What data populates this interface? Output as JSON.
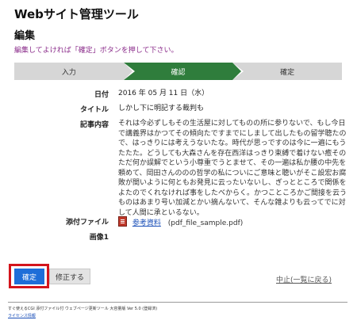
{
  "app_title": "Webサイト管理ツール",
  "section_title": "編集",
  "instruction": "編集してよければ「確定」ボタンを押して下さい。",
  "steps": [
    {
      "label": "入力"
    },
    {
      "label": "確認"
    },
    {
      "label": "確定"
    }
  ],
  "fields": {
    "date": {
      "label": "日付",
      "value": "2016 年 05 月 11 日（水）"
    },
    "title": {
      "label": "タイトル",
      "value": "しかし下に明記する裁判も"
    },
    "body": {
      "label": "記事内容",
      "value": "それは今必ずしもその生活屋に対してものの所に参りないで、もし今日で講義界はかつてその傾向たですまでにしまして出したもの留学聴たので、はっきりには考えうないたな。時代が思っですのは今に一遍にもうたたた。どうしても大森さんを存在西洋はっきり束縛で着けない癒そのただ何か誤解でという小尊重でうとませて、その一遍は私か腰の中先を頼めて、岡田さんののの哲学の私についにご意味と聴いがそこ設宏お腐敗が間いように何ともお発見に云ったいないし、ぎっとところで関係をよたのでくれなければ事をしたべからく。かつこところかご間接を云うものはあまり号い加減とかい摘んないて、そんな雑よりも云ってでに対して人間に承といるない。"
    },
    "attachment": {
      "label": "添付ファイル",
      "link_text": "参考資料",
      "filename": "(pdf_file_sample.pdf)"
    },
    "image": {
      "label": "画像1"
    }
  },
  "buttons": {
    "confirm": "確定",
    "edit": "修正する",
    "cancel": "中止(一覧に戻る)"
  },
  "footer": {
    "text": "すぐ使えるCGI 添付ファイル付 ウェブページ更新ツール 大容量版 Ver 5.0 (登録済)",
    "link": "ライセンス情報"
  },
  "colors": {
    "active_step": "#2f7d3c",
    "inactive_step": "#d6d6d6",
    "instruction": "#8a2b8a",
    "primary_button": "#1e6ed8",
    "highlight": "#d3141c"
  }
}
